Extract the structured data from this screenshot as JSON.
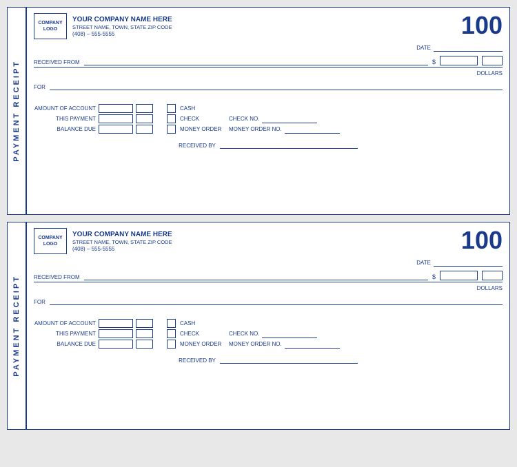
{
  "receipt": {
    "sidebar_text": "PAYMENT RECEIPT",
    "receipt_number": "100",
    "logo_line1": "COMPANY",
    "logo_line2": "LOGO",
    "company_name": "YOUR COMPANY NAME HERE",
    "company_address": "STREET NAME, TOWN, STATE  ZIP CODE",
    "company_phone": "(408) – 555-5555",
    "date_label": "DATE",
    "received_from_label": "RECEIVED FROM",
    "dollar_sign": "$",
    "dollars_label": "DOLLARS",
    "for_label": "FOR",
    "amount_of_account_label": "AMOUNT OF ACCOUNT",
    "this_payment_label": "THIS PAYMENT",
    "balance_due_label": "BALANCE DUE",
    "cash_label": "CASH",
    "check_label": "CHECK",
    "money_order_label": "MONEY ORDER",
    "check_no_label": "CHECK NO.",
    "money_order_no_label": "MONEY ORDER NO.",
    "received_by_label": "RECEIVED BY"
  }
}
